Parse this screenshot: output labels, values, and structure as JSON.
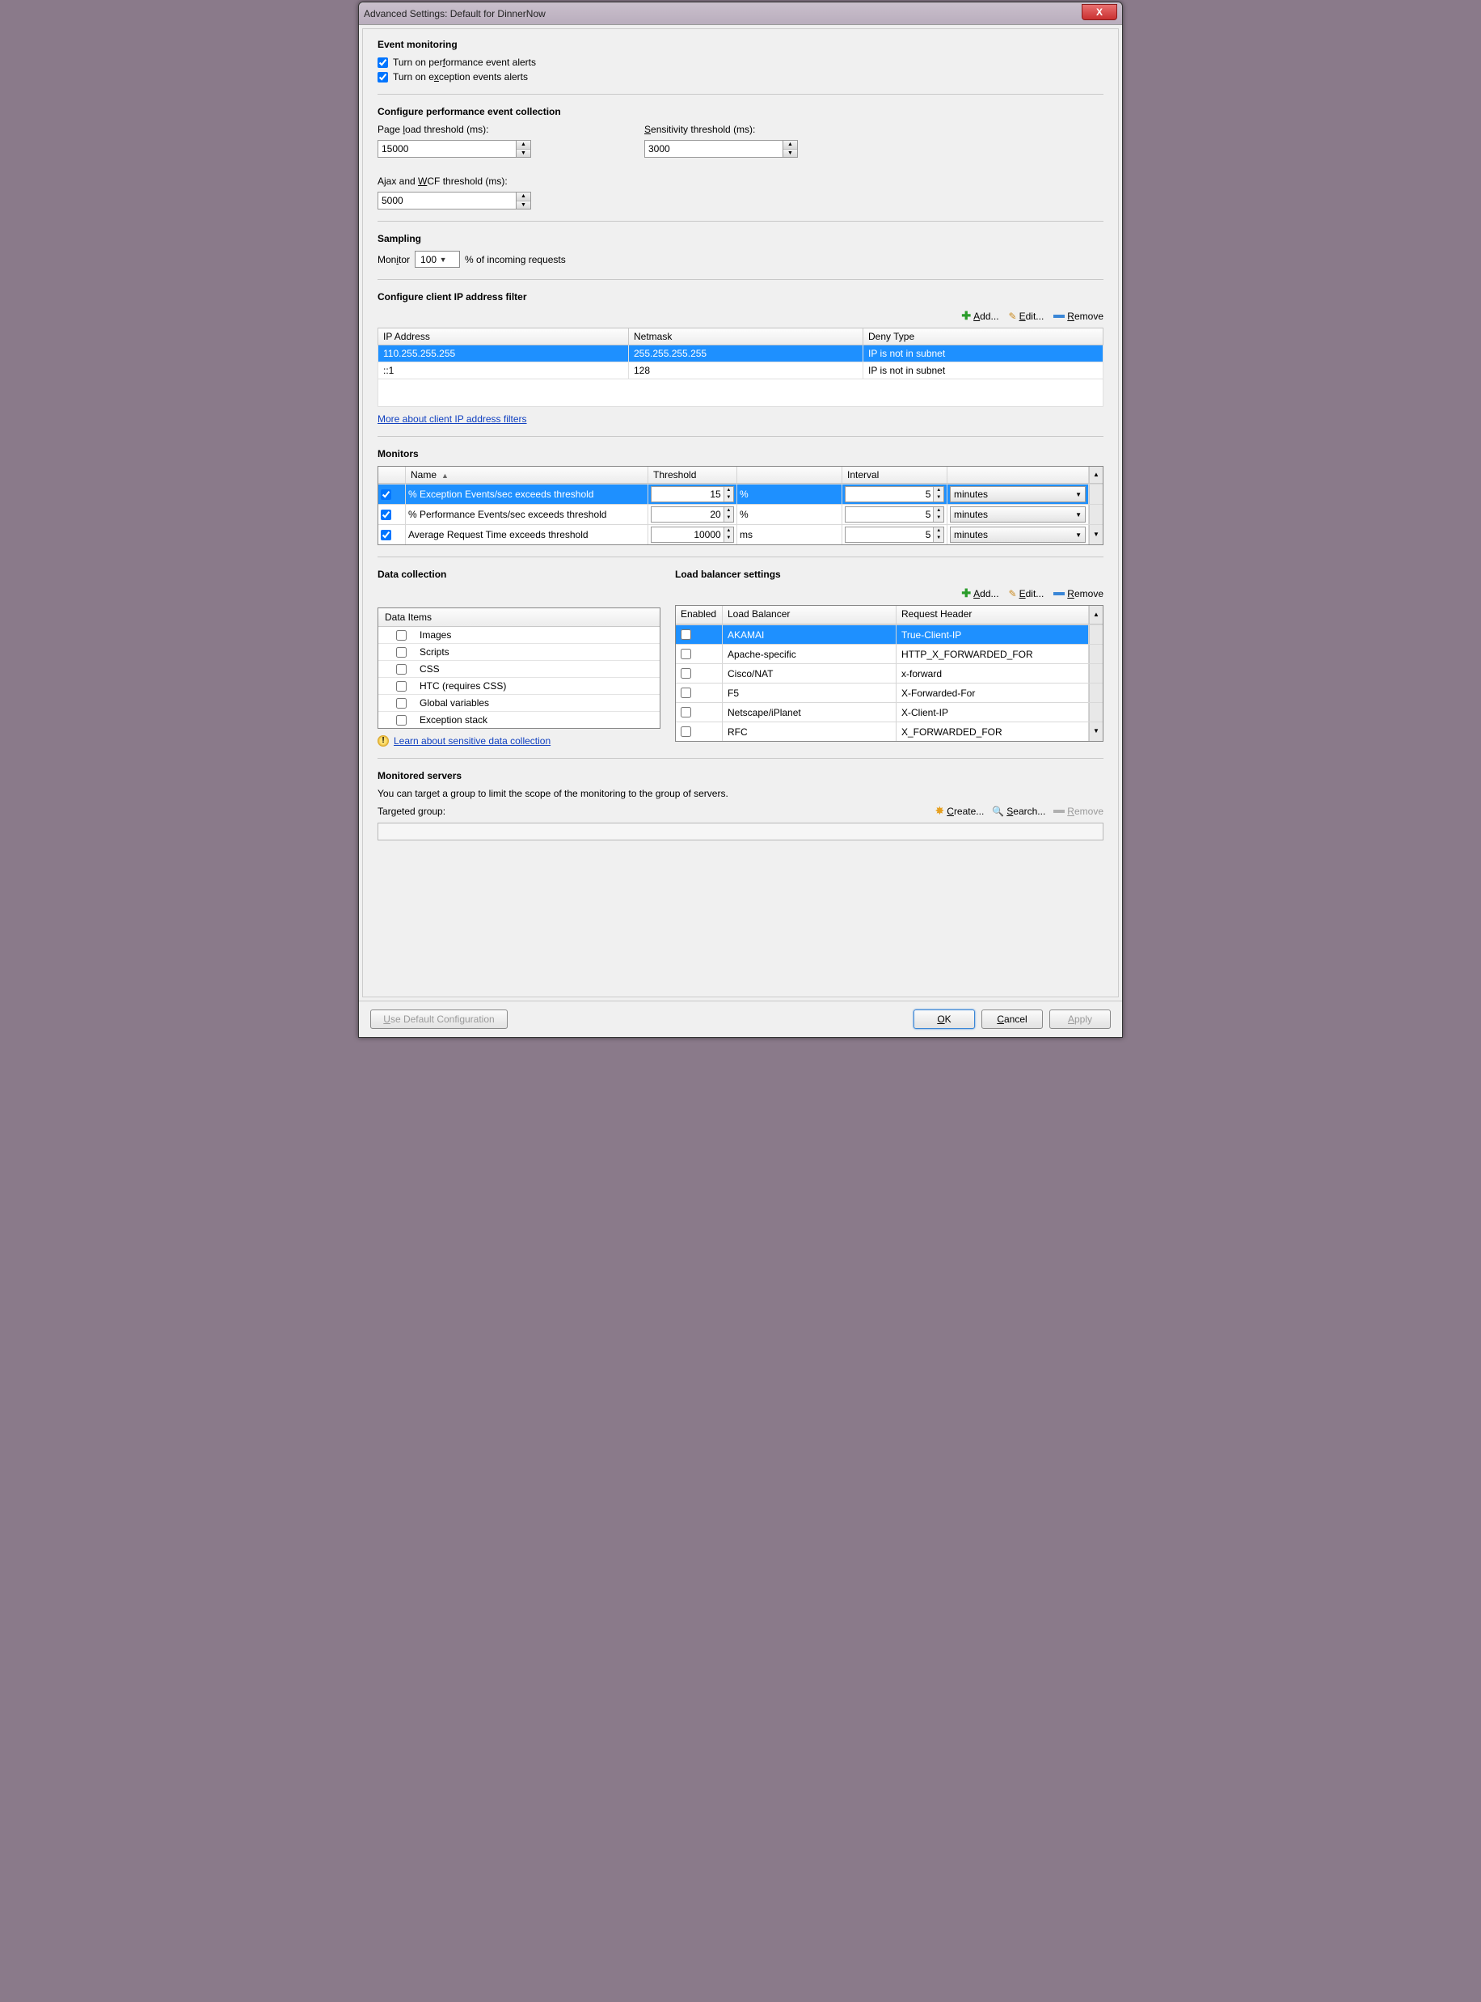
{
  "window": {
    "title": "Advanced Settings: Default for DinnerNow",
    "close": "X"
  },
  "event_monitoring": {
    "heading": "Event monitoring",
    "perf_alerts_label_pre": "Turn on per",
    "perf_alerts_label_u": "f",
    "perf_alerts_label_post": "ormance event alerts",
    "exc_alerts_label_pre": "Turn on e",
    "exc_alerts_label_u": "x",
    "exc_alerts_label_post": "ception events alerts"
  },
  "perf_collection": {
    "heading": "Configure performance event collection",
    "page_load_pre": "Page ",
    "page_load_u": "l",
    "page_load_post": "oad threshold (ms):",
    "page_load_value": "15000",
    "sens_u": "S",
    "sens_post": "ensitivity threshold (ms):",
    "sens_value": "3000",
    "ajax_pre": "Ajax and ",
    "ajax_u": "W",
    "ajax_post": "CF threshold (ms):",
    "ajax_value": "5000"
  },
  "sampling": {
    "heading": "Sampling",
    "monitor_pre": "Mon",
    "monitor_u": "i",
    "monitor_post": "tor",
    "value": "100",
    "suffix": "% of incoming requests"
  },
  "ip_filter": {
    "heading": "Configure client IP address filter",
    "add_u": "A",
    "add_post": "dd...",
    "edit_u": "E",
    "edit_post": "dit...",
    "remove_u": "R",
    "remove_post": "emove",
    "col_ip": "IP Address",
    "col_mask": "Netmask",
    "col_deny": "Deny Type",
    "rows": [
      {
        "ip": "110.255.255.255",
        "mask": "255.255.255.255",
        "deny": "IP is not in subnet"
      },
      {
        "ip": "::1",
        "mask": "128",
        "deny": "IP is not in subnet"
      }
    ],
    "more_link": "More about client IP address filters"
  },
  "monitors": {
    "heading": "Monitors",
    "col_name": "Name",
    "col_threshold": "Threshold",
    "col_interval": "Interval",
    "rows": [
      {
        "name": "% Exception Events/sec exceeds threshold",
        "thresh": "15",
        "unit": "%",
        "interval": "5",
        "intunit": "minutes"
      },
      {
        "name": "% Performance Events/sec exceeds threshold",
        "thresh": "20",
        "unit": "%",
        "interval": "5",
        "intunit": "minutes"
      },
      {
        "name": "Average Request Time exceeds threshold",
        "thresh": "10000",
        "unit": "ms",
        "interval": "5",
        "intunit": "minutes"
      }
    ]
  },
  "data_collection": {
    "heading": "Data collection",
    "header": "Data Items",
    "items": [
      "Images",
      "Scripts",
      "CSS",
      "HTC (requires CSS)",
      "Global variables",
      "Exception stack"
    ],
    "learn_link": "Learn about sensitive data collection"
  },
  "load_balancer": {
    "heading": "Load balancer settings",
    "add_u": "A",
    "add_post": "dd...",
    "edit_u": "E",
    "edit_post": "dit...",
    "remove_u": "R",
    "remove_post": "emove",
    "col_enabled": "Enabled",
    "col_name": "Load Balancer",
    "col_header": "Request Header",
    "rows": [
      {
        "name": "AKAMAI",
        "header": "True-Client-IP"
      },
      {
        "name": "Apache-specific",
        "header": "HTTP_X_FORWARDED_FOR"
      },
      {
        "name": "Cisco/NAT",
        "header": "x-forward"
      },
      {
        "name": "F5",
        "header": "X-Forwarded-For"
      },
      {
        "name": "Netscape/iPlanet",
        "header": "X-Client-IP"
      },
      {
        "name": "RFC",
        "header": "X_FORWARDED_FOR"
      }
    ]
  },
  "monitored_servers": {
    "heading": "Monitored servers",
    "desc": "You can target a group to limit the scope of the monitoring to the group of servers.",
    "targeted_label": "Targeted group:",
    "create_u": "C",
    "create_post": "reate...",
    "search_u": "S",
    "search_post": "earch...",
    "remove_u": "R",
    "remove_post": "emove"
  },
  "footer": {
    "use_default_pre": "",
    "use_default_u": "U",
    "use_default_post": "se Default Configuration",
    "ok_u": "O",
    "ok_post": "K",
    "cancel_u": "C",
    "cancel_post": "ancel",
    "apply_u": "A",
    "apply_post": "pply"
  }
}
